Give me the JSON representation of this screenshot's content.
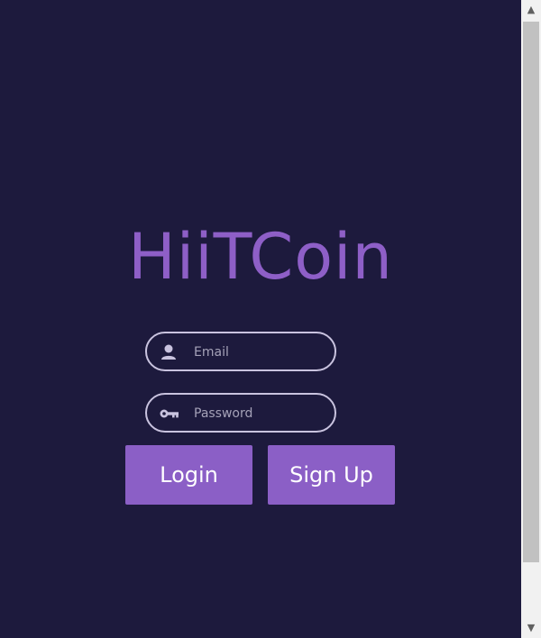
{
  "app": {
    "logo_text": "HiiTCoin",
    "brand_color": "#8e5fc7",
    "background_color": "#1d1a3d"
  },
  "login_form": {
    "email": {
      "placeholder": "Email",
      "value": "",
      "icon": "user-icon"
    },
    "password": {
      "placeholder": "Password",
      "value": "",
      "icon": "key-icon"
    },
    "login_label": "Login",
    "signup_label": "Sign Up",
    "button_color": "#8b5fc6"
  },
  "scrollbar": {
    "up_arrow": "▲",
    "down_arrow": "▼"
  }
}
